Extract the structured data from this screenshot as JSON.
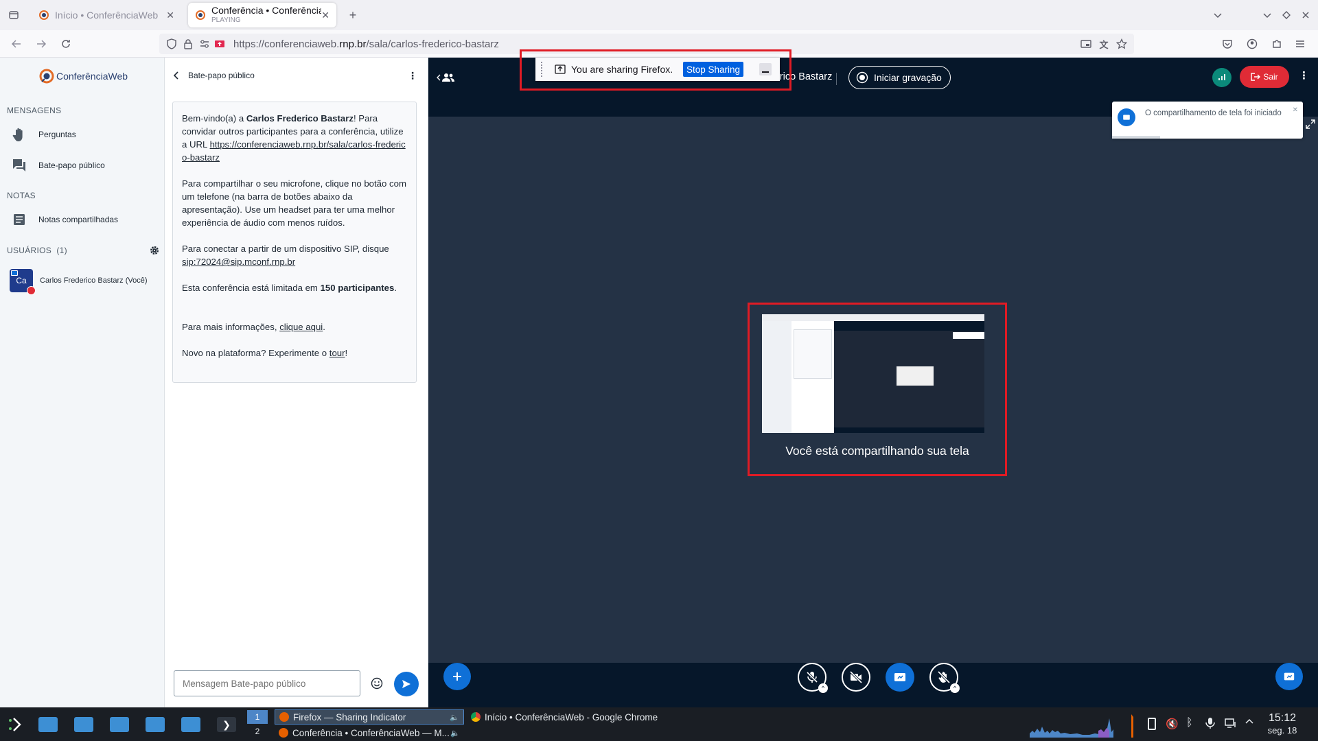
{
  "browser": {
    "tabs": [
      {
        "title": "Início • ConferênciaWeb",
        "subtitle": ""
      },
      {
        "title": "Conferência • ConferênciaW",
        "subtitle": "PLAYING"
      }
    ],
    "url_scheme_host_prefix": "https://conferenciaweb.",
    "url_domain": "rnp.br",
    "url_path": "/sala/carlos-frederico-bastarz"
  },
  "sidebar": {
    "logo_text": "ConferênciaWeb",
    "section_messages": "MENSAGENS",
    "item_questions": "Perguntas",
    "item_public_chat": "Bate-papo público",
    "section_notes": "NOTAS",
    "item_shared_notes": "Notas compartilhadas",
    "section_users": "USUÁRIOS",
    "users_count": "(1)",
    "user_avatar_initials": "Ca",
    "user_name": "Carlos Frederico Bastarz (Você)"
  },
  "chat": {
    "header_title": "Bate-papo público",
    "welcome": {
      "p1_a": "Bem-vindo(a) a ",
      "p1_name": "Carlos Frederico Bastarz",
      "p1_b": "! Para convidar outros participantes para a conferência, utilize a URL ",
      "p1_url": "https://conferenciaweb.rnp.br/sala/carlos-frederico-bastarz",
      "p2": "Para compartilhar o seu microfone, clique no botão com um telefone (na barra de botões abaixo da apresentação). Use um headset para ter uma melhor experiência de áudio com menos ruídos.",
      "p3_a": "Para conectar a partir de um dispositivo SIP, disque ",
      "p3_sip": "sip:72024@sip.mconf.rnp.br",
      "p4_a": "Esta conferência está limitada em ",
      "p4_b": "150 participantes",
      "p4_c": ".",
      "p5_a": "Para mais informações, ",
      "p5_link": "clique aqui",
      "p5_b": ".",
      "p6_a": "Novo na plataforma? Experimente o ",
      "p6_link": "tour",
      "p6_b": "!"
    },
    "input_placeholder": "Mensagem Bate-papo público"
  },
  "main": {
    "meeting_title": "Carlos Frederico Bastarz",
    "record_label": "Iniciar gravação",
    "leave_label": "Sair",
    "toast_text": "O compartilhamento de tela foi iniciado",
    "sharing_text": "Você está compartilhando sua tela"
  },
  "share_indicator": {
    "text": "You are sharing Firefox.",
    "stop_label": "Stop Sharing"
  },
  "taskbar": {
    "workspace_1": "1",
    "workspace_2": "2",
    "task_1": "Firefox — Sharing Indicator",
    "task_2": "Conferência • ConferênciaWeb — M...",
    "task_3": "Início • ConferênciaWeb - Google Chrome",
    "time": "15:12",
    "date": "seg. 18"
  },
  "colors": {
    "accent_blue": "#0f70d7",
    "leave_red": "#e02b36",
    "topbar_dark": "#06172a",
    "stage_bg": "#243245",
    "annotation_red": "#e01b24"
  }
}
